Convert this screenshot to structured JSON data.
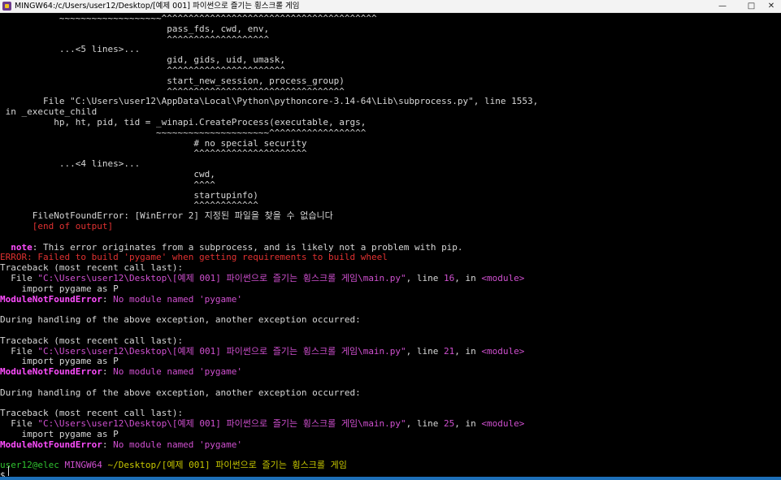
{
  "window": {
    "title": "MINGW64:/c/Users/user12/Desktop/[예제 001] 파이썬으로 즐기는 횡스크롤 게임",
    "minimize_glyph": "—",
    "maximize_glyph": "□",
    "close_glyph": "✕"
  },
  "terminal": {
    "lines": [
      {
        "segments": [
          {
            "text": "           ~~~~~~~~~~~~~~~~~~~^^^^^^^^^^^^^^^^^^^^^^^^^^^^^^^^^^^^^^^^",
            "color": "default"
          }
        ]
      },
      {
        "segments": [
          {
            "text": "                               pass_fds, cwd, env,",
            "color": "default"
          }
        ]
      },
      {
        "segments": [
          {
            "text": "                               ^^^^^^^^^^^^^^^^^^^",
            "color": "default"
          }
        ]
      },
      {
        "segments": [
          {
            "text": "           ...<5 lines>...",
            "color": "default"
          }
        ]
      },
      {
        "segments": [
          {
            "text": "                               gid, gids, uid, umask,",
            "color": "default"
          }
        ]
      },
      {
        "segments": [
          {
            "text": "                               ^^^^^^^^^^^^^^^^^^^^^^",
            "color": "default"
          }
        ]
      },
      {
        "segments": [
          {
            "text": "                               start_new_session, process_group)",
            "color": "default"
          }
        ]
      },
      {
        "segments": [
          {
            "text": "                               ^^^^^^^^^^^^^^^^^^^^^^^^^^^^^^^^^",
            "color": "default"
          }
        ]
      },
      {
        "segments": [
          {
            "text": "        File \"C:\\Users\\user12\\AppData\\Local\\Python\\pythoncore-3.14-64\\Lib\\subprocess.py\", line 1553,",
            "color": "default"
          }
        ]
      },
      {
        "segments": [
          {
            "text": " in _execute_child",
            "color": "default"
          }
        ]
      },
      {
        "segments": [
          {
            "text": "          hp, ht, pid, tid = _winapi.CreateProcess(executable, args,",
            "color": "default"
          }
        ]
      },
      {
        "segments": [
          {
            "text": "                             ~~~~~~~~~~~~~~~~~~~~~^^^^^^^^^^^^^^^^^^",
            "color": "default"
          }
        ]
      },
      {
        "segments": [
          {
            "text": "                                    # no special security",
            "color": "default"
          }
        ]
      },
      {
        "segments": [
          {
            "text": "                                    ^^^^^^^^^^^^^^^^^^^^^",
            "color": "default"
          }
        ]
      },
      {
        "segments": [
          {
            "text": "           ...<4 lines>...",
            "color": "default"
          }
        ]
      },
      {
        "segments": [
          {
            "text": "                                    cwd,",
            "color": "default"
          }
        ]
      },
      {
        "segments": [
          {
            "text": "                                    ^^^^",
            "color": "default"
          }
        ]
      },
      {
        "segments": [
          {
            "text": "                                    startupinfo)",
            "color": "default"
          }
        ]
      },
      {
        "segments": [
          {
            "text": "                                    ^^^^^^^^^^^^",
            "color": "default"
          }
        ]
      },
      {
        "segments": [
          {
            "text": "      FileNotFoundError: [WinError 2] 지정된 파일을 찾을 수 없습니다",
            "color": "default"
          }
        ]
      },
      {
        "segments": [
          {
            "text": "      [end of output]",
            "color": "red"
          }
        ]
      },
      {
        "segments": [
          {
            "text": "",
            "color": "default"
          }
        ]
      },
      {
        "segments": [
          {
            "text": "  note",
            "color": "magenta"
          },
          {
            "text": ": This error originates from a subprocess, and is likely not a problem with pip.",
            "color": "default"
          }
        ]
      },
      {
        "segments": [
          {
            "text": "ERROR: Failed to build 'pygame' when getting requirements to build wheel",
            "color": "red"
          }
        ]
      },
      {
        "segments": [
          {
            "text": "Traceback (most recent call last):",
            "color": "default"
          }
        ]
      },
      {
        "segments": [
          {
            "text": "  File ",
            "color": "default"
          },
          {
            "text": "\"C:\\Users\\user12\\Desktop\\[예제 001] 파이썬으로 즐기는 횡스크롤 게임\\main.py\"",
            "color": "path"
          },
          {
            "text": ", line ",
            "color": "default"
          },
          {
            "text": "16",
            "color": "path"
          },
          {
            "text": ", in ",
            "color": "default"
          },
          {
            "text": "<module>",
            "color": "path"
          }
        ]
      },
      {
        "segments": [
          {
            "text": "    import pygame as P",
            "color": "default"
          }
        ]
      },
      {
        "segments": [
          {
            "text": "ModuleNotFoundError",
            "color": "magenta"
          },
          {
            "text": ": ",
            "color": "default"
          },
          {
            "text": "No module named 'pygame'",
            "color": "path"
          }
        ]
      },
      {
        "segments": [
          {
            "text": "",
            "color": "default"
          }
        ]
      },
      {
        "segments": [
          {
            "text": "During handling of the above exception, another exception occurred:",
            "color": "default"
          }
        ]
      },
      {
        "segments": [
          {
            "text": "",
            "color": "default"
          }
        ]
      },
      {
        "segments": [
          {
            "text": "Traceback (most recent call last):",
            "color": "default"
          }
        ]
      },
      {
        "segments": [
          {
            "text": "  File ",
            "color": "default"
          },
          {
            "text": "\"C:\\Users\\user12\\Desktop\\[예제 001] 파이썬으로 즐기는 횡스크롤 게임\\main.py\"",
            "color": "path"
          },
          {
            "text": ", line ",
            "color": "default"
          },
          {
            "text": "21",
            "color": "path"
          },
          {
            "text": ", in ",
            "color": "default"
          },
          {
            "text": "<module>",
            "color": "path"
          }
        ]
      },
      {
        "segments": [
          {
            "text": "    import pygame as P",
            "color": "default"
          }
        ]
      },
      {
        "segments": [
          {
            "text": "ModuleNotFoundError",
            "color": "magenta"
          },
          {
            "text": ": ",
            "color": "default"
          },
          {
            "text": "No module named 'pygame'",
            "color": "path"
          }
        ]
      },
      {
        "segments": [
          {
            "text": "",
            "color": "default"
          }
        ]
      },
      {
        "segments": [
          {
            "text": "During handling of the above exception, another exception occurred:",
            "color": "default"
          }
        ]
      },
      {
        "segments": [
          {
            "text": "",
            "color": "default"
          }
        ]
      },
      {
        "segments": [
          {
            "text": "Traceback (most recent call last):",
            "color": "default"
          }
        ]
      },
      {
        "segments": [
          {
            "text": "  File ",
            "color": "default"
          },
          {
            "text": "\"C:\\Users\\user12\\Desktop\\[예제 001] 파이썬으로 즐기는 횡스크롤 게임\\main.py\"",
            "color": "path"
          },
          {
            "text": ", line ",
            "color": "default"
          },
          {
            "text": "25",
            "color": "path"
          },
          {
            "text": ", in ",
            "color": "default"
          },
          {
            "text": "<module>",
            "color": "path"
          }
        ]
      },
      {
        "segments": [
          {
            "text": "    import pygame as P",
            "color": "default"
          }
        ]
      },
      {
        "segments": [
          {
            "text": "ModuleNotFoundError",
            "color": "magenta"
          },
          {
            "text": ": ",
            "color": "default"
          },
          {
            "text": "No module named 'pygame'",
            "color": "path"
          }
        ]
      },
      {
        "segments": [
          {
            "text": "",
            "color": "default"
          }
        ]
      },
      {
        "segments": [
          {
            "text": "user12@elec ",
            "color": "green"
          },
          {
            "text": "MINGW64 ",
            "color": "path"
          },
          {
            "text": "~/Desktop/[예제 001] 파이썬으로 즐기는 횡스크롤 게임",
            "color": "yellow"
          }
        ]
      },
      {
        "segments": [
          {
            "text": "$ ",
            "color": "default"
          }
        ]
      }
    ]
  },
  "colors": {
    "background": "#000000",
    "text": "#d7d7d7",
    "error_red": "#e03131",
    "magenta": "#ff4dff",
    "path_purple": "#d050d0",
    "prompt_green": "#2fc02f",
    "prompt_yellow": "#c8c800",
    "taskbar_blue": "#1d6fb8"
  }
}
